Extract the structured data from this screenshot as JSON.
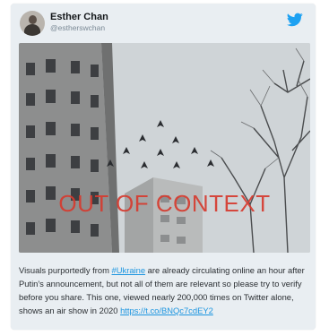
{
  "tweet": {
    "author_name": "Esther Chan",
    "author_handle": "@estherswchan",
    "overlay_text": "OUT OF CONTEXT",
    "body_before": "Visuals purportedly from ",
    "hashtag": "#Ukraine",
    "body_after": " are already circulating online an hour after Putin's announcement, but not all of them are relevant so please try to verify before you share. This one, viewed nearly 200,000 times on Twitter alone, shows an air show in 2020 ",
    "link": "https://t.co/BNQc7cdEY2"
  },
  "colors": {
    "card_bg": "#e9eef2",
    "twitter_blue": "#1b95e0",
    "overlay_red": "#d63b2f"
  },
  "icons": {
    "brand": "twitter-bird-icon",
    "avatar": "user-avatar"
  }
}
